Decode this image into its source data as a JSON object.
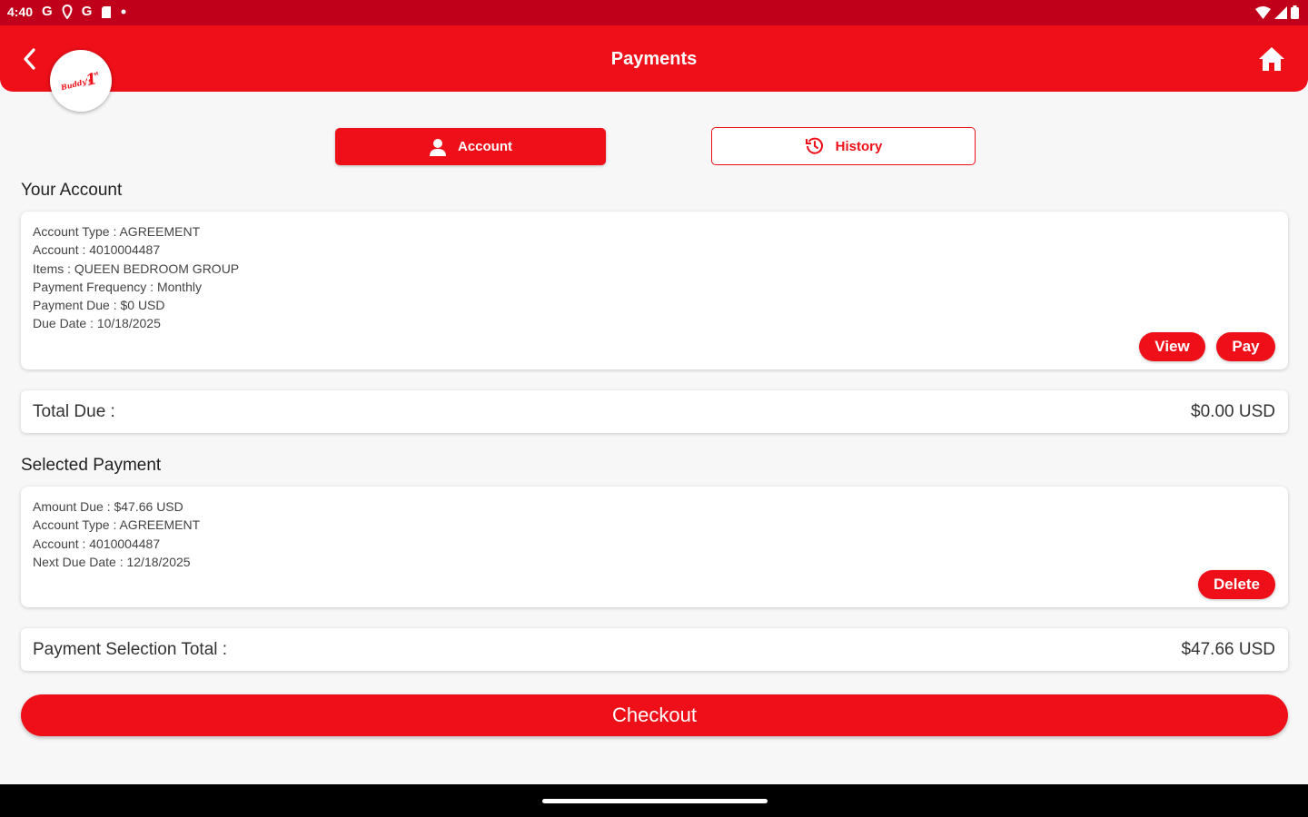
{
  "status_bar": {
    "time": "4:40",
    "icons": [
      "google-g-icon",
      "location-pin-icon",
      "google-g-icon",
      "sd-card-icon",
      "dot-icon",
      "wifi-icon",
      "signal-icon",
      "battery-icon"
    ]
  },
  "app_bar": {
    "title": "Payments",
    "logo_text": "Buddy's",
    "logo_mark": "1st"
  },
  "tabs": {
    "account_label": "Account",
    "history_label": "History"
  },
  "account_section": {
    "title": "Your Account",
    "lines": [
      "Account Type : AGREEMENT",
      "Account : 4010004487",
      "Items : QUEEN BEDROOM GROUP",
      "Payment Frequency : Monthly",
      "Payment Due : $0 USD",
      "Due Date : 10/18/2025"
    ],
    "view_label": "View",
    "pay_label": "Pay"
  },
  "total_due": {
    "label": "Total Due :",
    "value": "$0.00 USD"
  },
  "selected_section": {
    "title": "Selected Payment",
    "lines": [
      "Amount Due : $47.66 USD",
      "Account Type : AGREEMENT",
      "Account : 4010004487",
      "Next Due Date : 12/18/2025"
    ],
    "delete_label": "Delete"
  },
  "selection_total": {
    "label": "Payment Selection Total :",
    "value": "$47.66 USD"
  },
  "checkout_label": "Checkout",
  "colors": {
    "brand_red": "#ee0f18",
    "status_red": "#c0001a",
    "background": "#f7f7f7"
  }
}
